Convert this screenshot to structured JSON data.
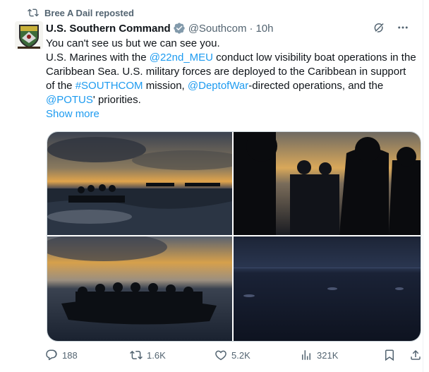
{
  "repost": {
    "label": "Bree A Dail reposted",
    "icon": "repost-icon"
  },
  "author": {
    "name": "U.S. Southern Command",
    "handle": "@Southcom",
    "separator": "·",
    "time": "10h"
  },
  "tweet": {
    "line1": "You can't see us but we can see you.",
    "seg1": "U.S. Marines with the ",
    "mention1": "@22nd_MEU",
    "seg2": " conduct low visibility boat operations in the Caribbean Sea. U.S. military forces are deployed to the Caribbean in support of the ",
    "hashtag1": "#SOUTHCOM",
    "seg3": " mission, ",
    "mention2": "@DeptofWar",
    "seg4": "-directed operations, and the ",
    "mention3": "@POTUS",
    "seg5": "' priorities.",
    "show_more": "Show more"
  },
  "actions": {
    "reply_count": "188",
    "repost_count": "1.6K",
    "like_count": "5.2K",
    "views_count": "321K"
  },
  "colors": {
    "link": "#1d9bf0",
    "secondary_text": "#536471",
    "verified_badge": "#829aab"
  }
}
